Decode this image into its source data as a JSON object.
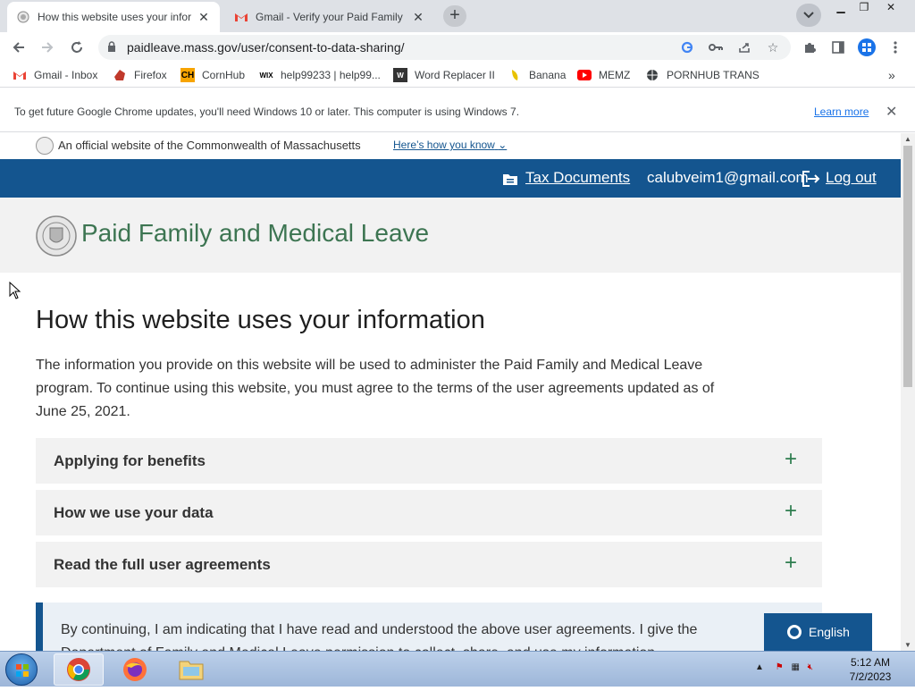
{
  "browser": {
    "tabs": [
      {
        "title": "How this website uses your infor",
        "active": true
      },
      {
        "title": "Gmail - Verify your Paid Family ar",
        "active": false
      }
    ],
    "url": "paidleave.mass.gov/user/consent-to-data-sharing/",
    "bookmarks": [
      {
        "label": "Gmail - Inbox",
        "icon": "gmail-icon"
      },
      {
        "label": "Firefox",
        "icon": "firefox-icon"
      },
      {
        "label": "CornHub",
        "icon": "cornhub-icon"
      },
      {
        "label": "help99233 | help99...",
        "icon": "wix-icon"
      },
      {
        "label": "Word Replacer II",
        "icon": "word-replacer-icon"
      },
      {
        "label": "Banana",
        "icon": "banana-icon"
      },
      {
        "label": "MEMZ",
        "icon": "youtube-icon"
      },
      {
        "label": "PORNHUB TRANS",
        "icon": "globe-icon"
      }
    ],
    "infobar": {
      "message": "To get future Google Chrome updates, you'll need Windows 10 or later. This computer is using Windows 7.",
      "learn_more": "Learn more"
    }
  },
  "page": {
    "gov_banner": {
      "text": "An official website of the Commonwealth of Massachusetts",
      "how_link": "Here’s how you know"
    },
    "topnav": {
      "tax_documents": "Tax Documents",
      "email": "calubveim1@gmail.com",
      "logout": "Log out"
    },
    "brand": "Paid Family and Medical Leave",
    "heading": "How this website uses your information",
    "intro": "The information you provide on this website will be used to administer the Paid Family and Medical Leave program. To continue using this website, you must agree to the terms of the user agreements updated as of June 25, 2021.",
    "accordions": [
      {
        "label": "Applying for benefits"
      },
      {
        "label": "How we use your data"
      },
      {
        "label": "Read the full user agreements"
      }
    ],
    "consent_text": "By continuing, I am indicating that I have read and understood the above user agreements. I give the Department of Family and Medical Leave permission to collect, share, and use my information",
    "language": "English"
  },
  "taskbar": {
    "time": "5:12 AM",
    "date": "7/2/2023"
  },
  "colors": {
    "nav_blue": "#14558f",
    "brand_green": "#3d7552",
    "plus_green": "#2e7d4f"
  }
}
